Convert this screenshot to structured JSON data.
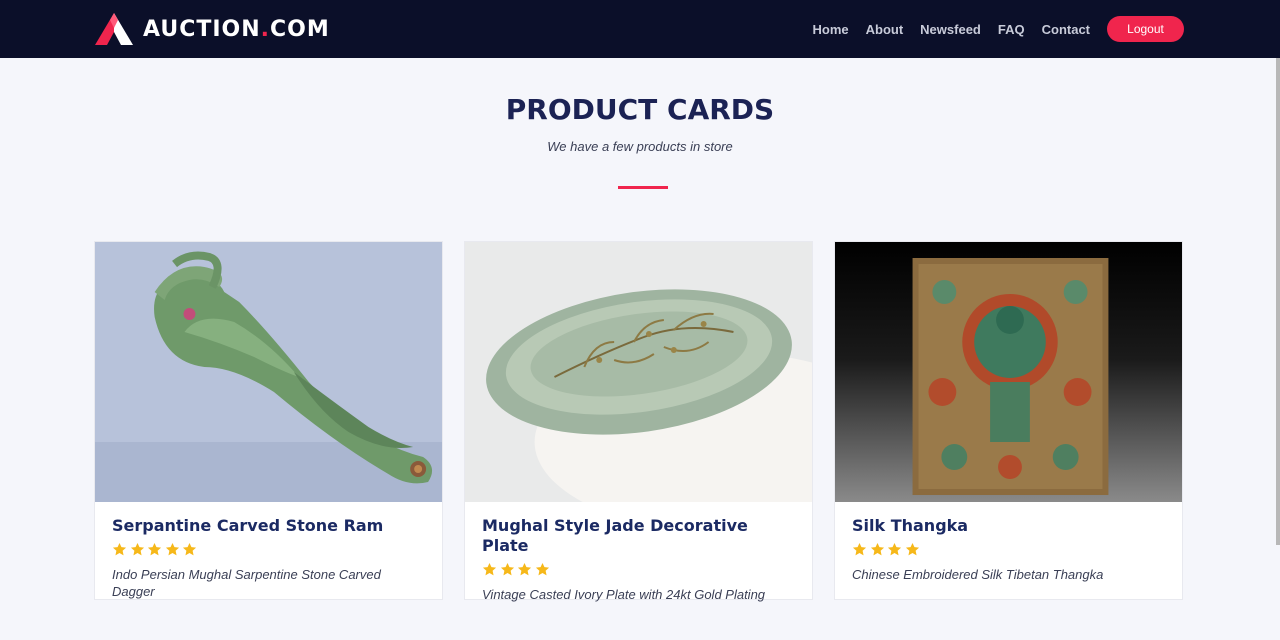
{
  "brand": {
    "name": "AUCTION",
    "dot": ".",
    "tld": "COM"
  },
  "nav": {
    "items": [
      {
        "label": "Home"
      },
      {
        "label": "About"
      },
      {
        "label": "Newsfeed"
      },
      {
        "label": "FAQ"
      },
      {
        "label": "Contact"
      }
    ],
    "logout_label": "Logout"
  },
  "section": {
    "title": "PRODUCT CARDS",
    "subtitle": "We have a few products in store"
  },
  "products": [
    {
      "title": "Serpantine Carved Stone Ram",
      "rating": 5,
      "description": "Indo Persian Mughal Sarpentine Stone Carved Dagger"
    },
    {
      "title": "Mughal Style Jade Decorative Plate",
      "rating": 4,
      "description": "Vintage Casted Ivory Plate with 24kt Gold Plating"
    },
    {
      "title": "Silk Thangka",
      "rating": 4,
      "description": "Chinese Embroidered Silk Tibetan Thangka"
    }
  ],
  "colors": {
    "navbar": "#0b0f29",
    "accent": "#f0254d",
    "title": "#1b2254",
    "star": "#f6b81a"
  },
  "icons": [
    "auction-logo-icon",
    "star-icon"
  ]
}
